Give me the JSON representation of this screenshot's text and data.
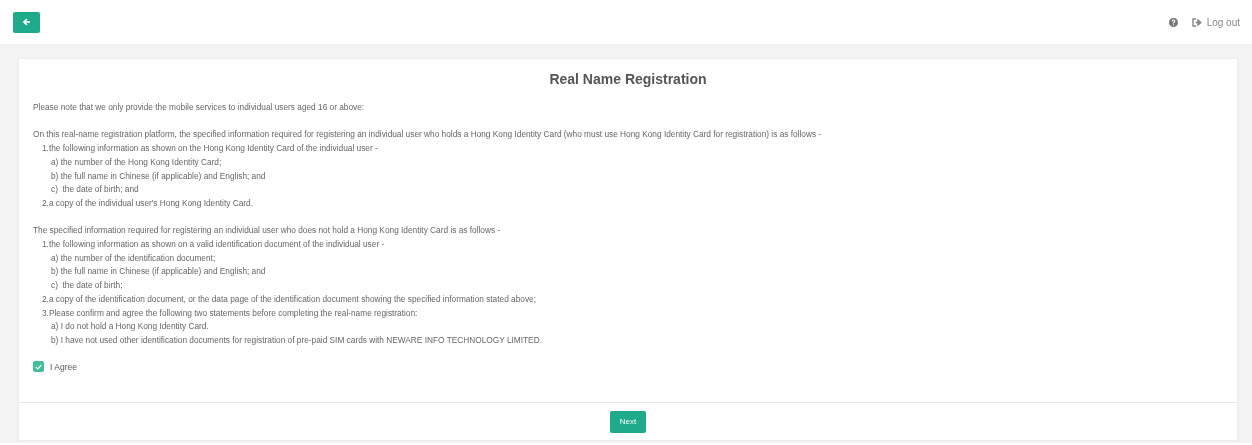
{
  "header": {
    "logout": "Log out"
  },
  "card": {
    "title": "Real Name Registration",
    "paragraphs": [
      {
        "text": "Please note that we only provide the mobile services to individual users aged 16 or above:"
      },
      {
        "text": "On this real-name registration platform, the specified information required for registering an individual user who holds a Hong Kong Identity Card (who must use Hong Kong Identity Card for registration) is as follows -",
        "children": [
          {
            "text": "1.the following information as shown on the Hong Kong Identity Card of the individual user -",
            "children": [
              {
                "text": "a) the number of the Hong Kong Identity Card;"
              },
              {
                "text": "b) the full name in Chinese (if applicable) and English; and"
              },
              {
                "text": "c)  the date of birth; and"
              }
            ]
          },
          {
            "text": "2.a copy of the individual user's Hong Kong Identity Card."
          }
        ]
      },
      {
        "text": "The specified information required for registering an individual user who does not hold a Hong Kong Identity Card is as follows -",
        "children": [
          {
            "text": "1.the following information as shown on a valid identification document of the individual user -",
            "children": [
              {
                "text": "a) the number of the identification document;"
              },
              {
                "text": "b) the full name in Chinese (if applicable) and English; and"
              },
              {
                "text": "c)  the date of birth;"
              }
            ]
          },
          {
            "text": "2.a copy of the identification document, or the data page of the identification document showing the specified information stated above;"
          },
          {
            "text": "3.Please confirm and agree the following two statements before completing the real-name registration:",
            "children": [
              {
                "text": "a) I do not hold a Hong Kong Identity Card."
              },
              {
                "text": "b) I have not used other identification documents for registration of pre-paid SIM cards with NEWARE INFO TECHNOLOGY LIMITED."
              }
            ]
          }
        ]
      }
    ],
    "agree": {
      "label": "I Agree",
      "checked": true
    },
    "next_button": "Next"
  }
}
